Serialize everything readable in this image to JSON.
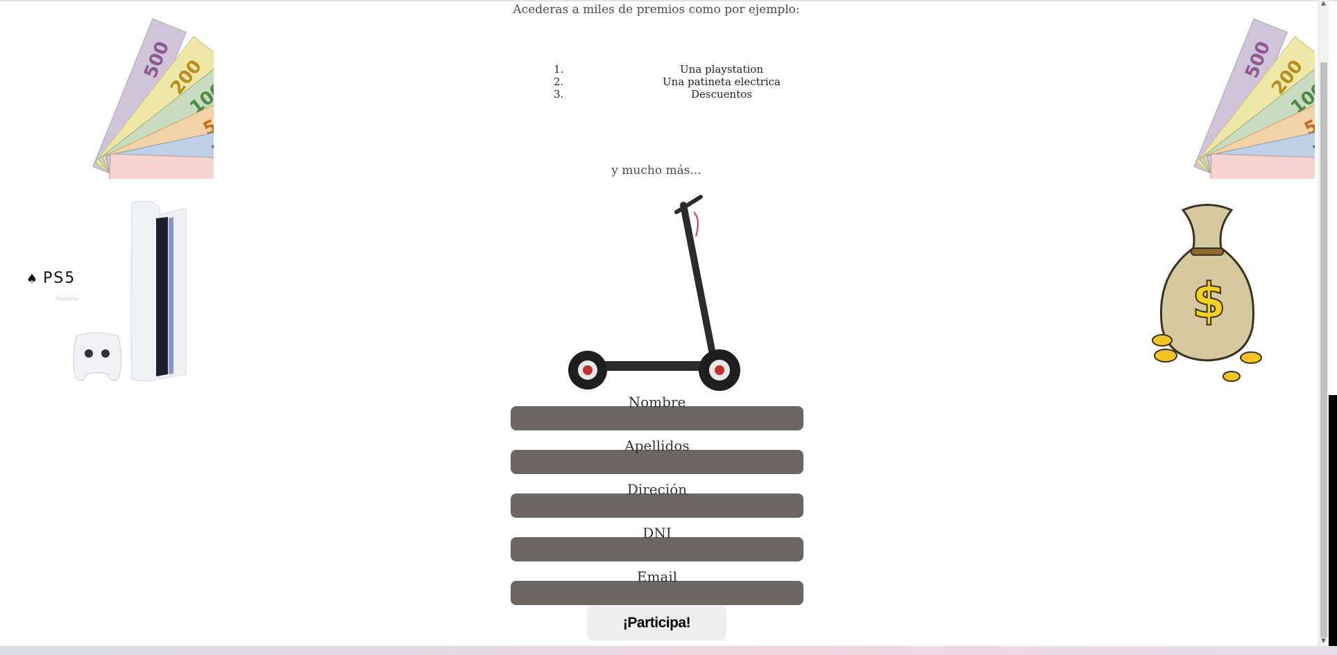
{
  "intro_text": "Acederas a miles de premios como por ejemplo:",
  "prizes": [
    {
      "num": "1.",
      "label": "Una playstation"
    },
    {
      "num": "2.",
      "label": "Una patineta electrica"
    },
    {
      "num": "3.",
      "label": "Descuentos"
    }
  ],
  "more_text": "y mucho más...",
  "ps5_logo_text": "PS5",
  "form": {
    "fields": [
      {
        "label": "Nombre",
        "value": ""
      },
      {
        "label": "Apellidos",
        "value": ""
      },
      {
        "label": "Direción",
        "value": ""
      },
      {
        "label": "DNI",
        "value": ""
      },
      {
        "label": "Email",
        "value": ""
      }
    ],
    "submit_label": "¡Participa!"
  },
  "colors": {
    "input_bg": "#6b6661",
    "button_bg": "#eeeeee",
    "page_bg": "#ffffff"
  },
  "icons": [
    "euro-banknotes-icon",
    "ps5-console-icon",
    "electric-scooter-icon",
    "money-bag-icon"
  ]
}
